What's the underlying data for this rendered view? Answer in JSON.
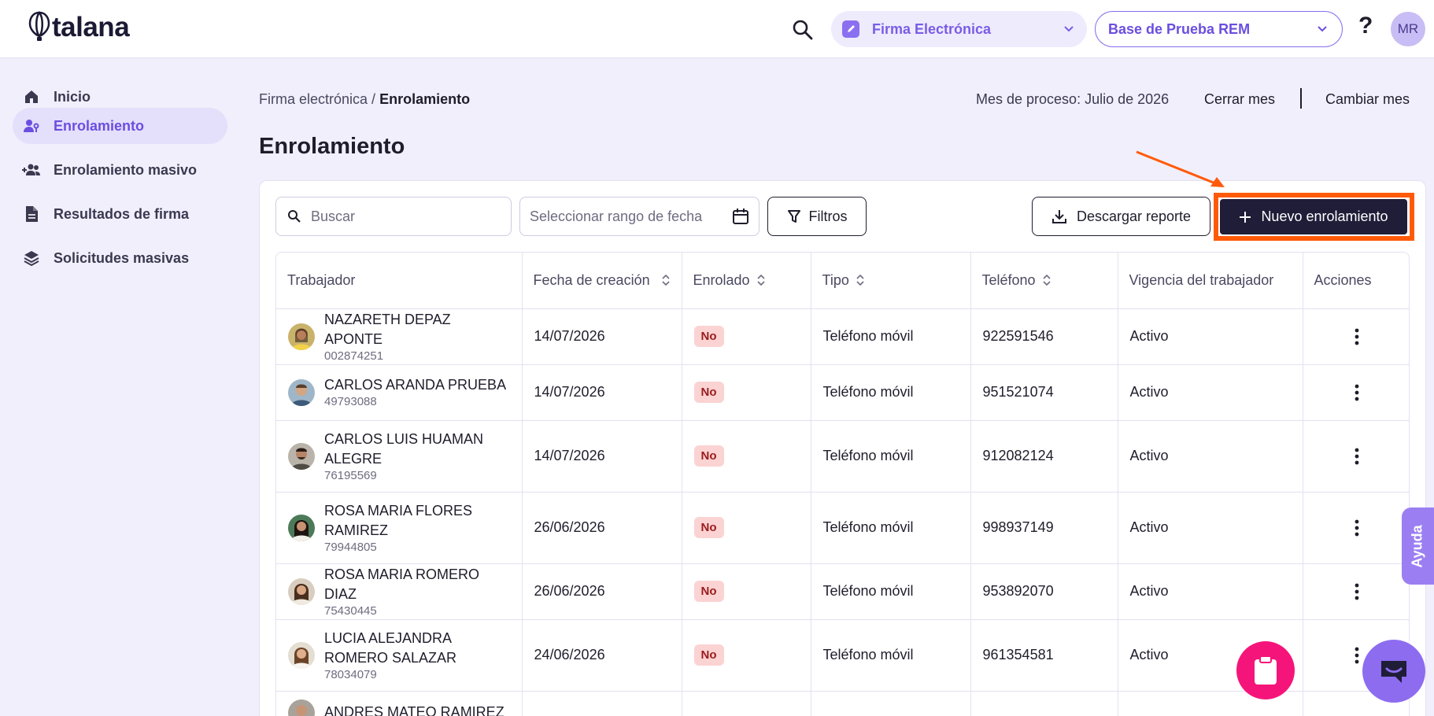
{
  "brand": {
    "name": "talana"
  },
  "header": {
    "module": "Firma Electrónica",
    "company": "Base de Prueba REM",
    "help": "?",
    "user_initials": "MR"
  },
  "sidebar": {
    "items": [
      {
        "label": "Inicio",
        "icon": "home-icon"
      },
      {
        "label": "Enrolamiento",
        "icon": "user-key-icon",
        "active": true
      },
      {
        "label": "Enrolamiento masivo",
        "icon": "group-add-icon"
      },
      {
        "label": "Resultados de firma",
        "icon": "document-icon"
      },
      {
        "label": "Solicitudes masivas",
        "icon": "layers-icon"
      }
    ]
  },
  "breadcrumb": {
    "parent": "Firma electrónica",
    "separator": " / ",
    "current": "Enrolamiento"
  },
  "period": {
    "label": "Mes de proceso: Julio de 2026",
    "close": "Cerrar mes",
    "change": "Cambiar mes"
  },
  "page_title": "Enrolamiento",
  "toolbar": {
    "search_placeholder": "Buscar",
    "date_placeholder": "Seleccionar rango de fecha",
    "filters": "Filtros",
    "download": "Descargar reporte",
    "new": "Nuevo enrolamiento"
  },
  "table": {
    "headers": [
      "Trabajador",
      "Fecha de creación",
      "Enrolado",
      "Tipo",
      "Teléfono",
      "Vigencia del trabajador",
      "Acciones"
    ],
    "rows": [
      {
        "name": "NAZARETH DEPAZ APONTE",
        "id": "002874251",
        "date": "14/07/2026",
        "enrolled": "No",
        "type": "Teléfono móvil",
        "phone": "922591546",
        "status": "Activo"
      },
      {
        "name": "CARLOS ARANDA PRUEBA",
        "id": "49793088",
        "date": "14/07/2026",
        "enrolled": "No",
        "type": "Teléfono móvil",
        "phone": "951521074",
        "status": "Activo"
      },
      {
        "name": "CARLOS LUIS HUAMAN ALEGRE",
        "id": "76195569",
        "date": "14/07/2026",
        "enrolled": "No",
        "type": "Teléfono móvil",
        "phone": "912082124",
        "status": "Activo"
      },
      {
        "name": "ROSA MARIA FLORES RAMIREZ",
        "id": "79944805",
        "date": "26/06/2026",
        "enrolled": "No",
        "type": "Teléfono móvil",
        "phone": "998937149",
        "status": "Activo"
      },
      {
        "name": "ROSA MARIA ROMERO DIAZ",
        "id": "75430445",
        "date": "26/06/2026",
        "enrolled": "No",
        "type": "Teléfono móvil",
        "phone": "953892070",
        "status": "Activo"
      },
      {
        "name": "LUCIA ALEJANDRA ROMERO SALAZAR",
        "id": "78034079",
        "date": "24/06/2026",
        "enrolled": "No",
        "type": "Teléfono móvil",
        "phone": "961354581",
        "status": "Activo"
      },
      {
        "name": "ANDRES MATEO RAMIREZ",
        "id": "",
        "date": "",
        "enrolled": "",
        "type": "",
        "phone": "",
        "status": ""
      }
    ]
  },
  "floating": {
    "help_tab": "Ayuda"
  },
  "colors": {
    "accent": "#7a5ce6",
    "primary_dark": "#1f1d38",
    "highlight": "#ff5a0a",
    "badge_bg": "#fbd3d3",
    "pink": "#f5157a"
  }
}
